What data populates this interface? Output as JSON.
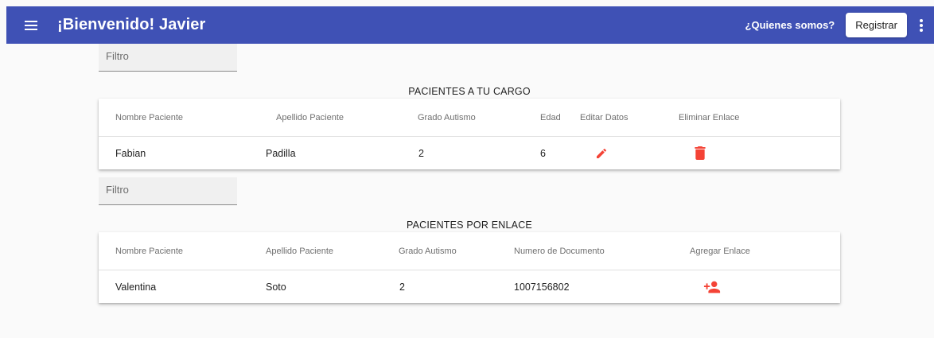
{
  "toolbar": {
    "menu_icon": "menu-icon",
    "title": "¡Bienvenido! Javier",
    "about_link": "¿Quienes somos?",
    "register_label": "Registrar",
    "more_icon": "more-vert-icon",
    "color": "#3f51b5"
  },
  "section1": {
    "filter_placeholder": "Filtro",
    "title": "PACIENTES A TU CARGO",
    "columns": [
      "Nombre Paciente",
      "Apellido Paciente",
      "Grado Autismo",
      "Edad",
      "Editar Datos",
      "Eliminar Enlace"
    ],
    "rows": [
      {
        "nombre": "Fabian",
        "apellido": "Padilla",
        "grado": "2",
        "edad": "6",
        "edit_icon": "pencil-icon",
        "delete_icon": "trash-icon"
      }
    ]
  },
  "section2": {
    "filter_placeholder": "Filtro",
    "title": "PACIENTES POR ENLACE",
    "columns": [
      "Nombre Paciente",
      "Apellido Paciente",
      "Grado Autismo",
      "Numero de Documento",
      "Agregar Enlace"
    ],
    "rows": [
      {
        "nombre": "Valentina",
        "apellido": "Soto",
        "grado": "2",
        "documento": "1007156802",
        "add_icon": "person-add-icon"
      }
    ]
  },
  "accent_color": "#f44336"
}
